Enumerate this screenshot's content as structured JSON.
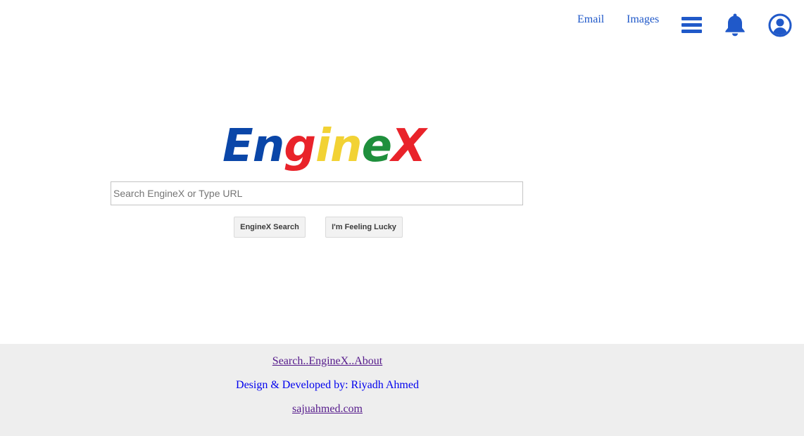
{
  "nav": {
    "email_label": "Email",
    "images_label": "Images",
    "menu_icon": "hamburger-menu-icon",
    "bell_icon": "bell-icon",
    "user_icon": "user-account-icon",
    "icon_color": "#2059c9"
  },
  "logo": {
    "letters": [
      {
        "char": "E",
        "color": "#0a46a8"
      },
      {
        "char": "n",
        "color": "#0a46a8"
      },
      {
        "char": "g",
        "color": "#e9232a"
      },
      {
        "char": "i",
        "color": "#f2d234"
      },
      {
        "char": "n",
        "color": "#f2d234"
      },
      {
        "char": "e",
        "color": "#1e8f3c"
      },
      {
        "char": "X",
        "color": "#e9232a"
      }
    ]
  },
  "search": {
    "placeholder": "Search EngineX or Type URL",
    "value": "",
    "search_button": "EngineX Search",
    "lucky_button": "I'm Feeling Lucky"
  },
  "footer": {
    "link1": "Search..EngineX..About",
    "credit": "Design & Developed by: Riyadh Ahmed",
    "link2": "sajuahmed.com"
  }
}
